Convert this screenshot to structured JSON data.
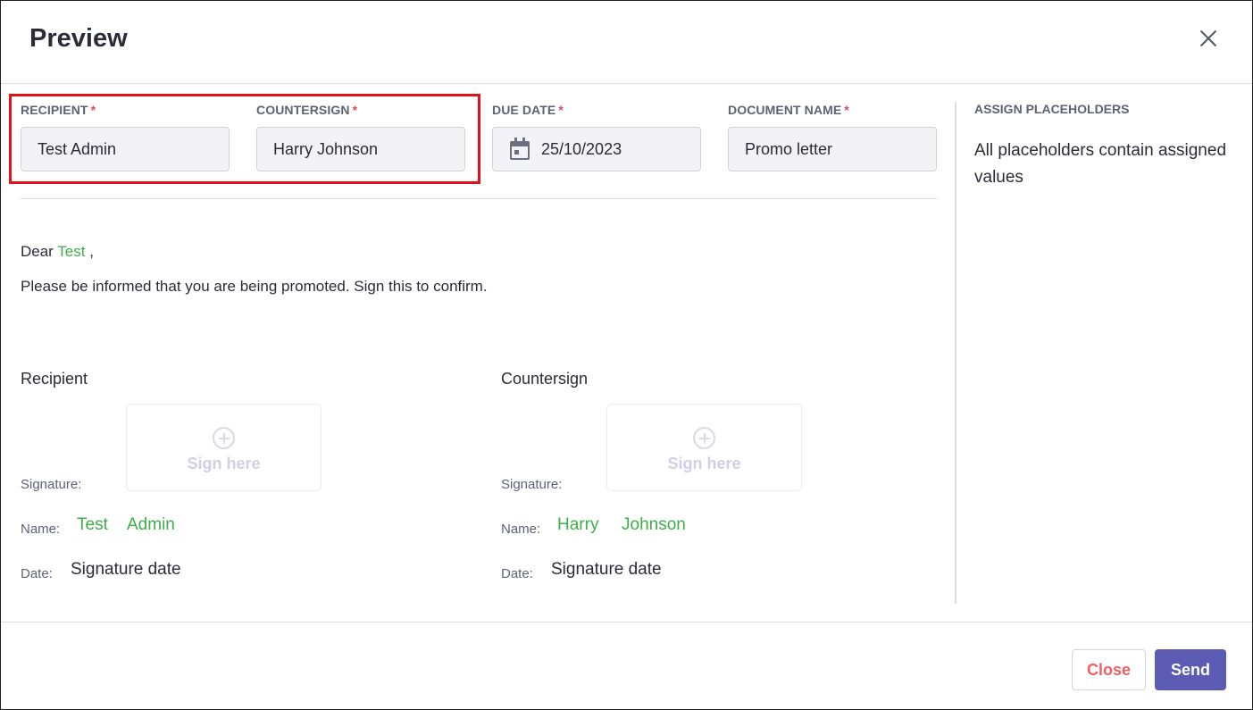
{
  "modal": {
    "title": "Preview"
  },
  "fields": {
    "recipient": {
      "label": "RECIPIENT",
      "required_mark": "*",
      "value": "Test Admin"
    },
    "countersign": {
      "label": "COUNTERSIGN",
      "required_mark": "*",
      "value": "Harry Johnson"
    },
    "due_date": {
      "label": "DUE DATE",
      "required_mark": "*",
      "value": "25/10/2023"
    },
    "document_name": {
      "label": "DOCUMENT NAME",
      "required_mark": "*",
      "value": "Promo letter"
    }
  },
  "document": {
    "greeting_prefix": "Dear",
    "greeting_name": "Test",
    "greeting_suffix": ",",
    "body": "Please be informed that you are being promoted. Sign this to confirm."
  },
  "signatures": {
    "recipient": {
      "heading": "Recipient",
      "signature_label": "Signature:",
      "sign_placeholder": "Sign here",
      "name_label": "Name:",
      "first_name": "Test",
      "last_name": "Admin",
      "date_label": "Date:",
      "date_value": "Signature date"
    },
    "countersign": {
      "heading": "Countersign",
      "signature_label": "Signature:",
      "sign_placeholder": "Sign here",
      "name_label": "Name:",
      "first_name": "Harry",
      "last_name": "Johnson",
      "date_label": "Date:",
      "date_value": "Signature date"
    }
  },
  "sidebar": {
    "title": "ASSIGN PLACEHOLDERS",
    "message": "All placeholders contain assigned values"
  },
  "footer": {
    "close_label": "Close",
    "send_label": "Send"
  },
  "colors": {
    "accent": "#5c5bb4",
    "placeholder_green": "#3cae4a",
    "required_red": "#e0484f",
    "highlight_red": "#e0121c",
    "close_text": "#ef6064"
  },
  "icons": {
    "close": "close-icon",
    "calendar": "calendar-icon",
    "sign_add": "plus-circle-icon"
  }
}
